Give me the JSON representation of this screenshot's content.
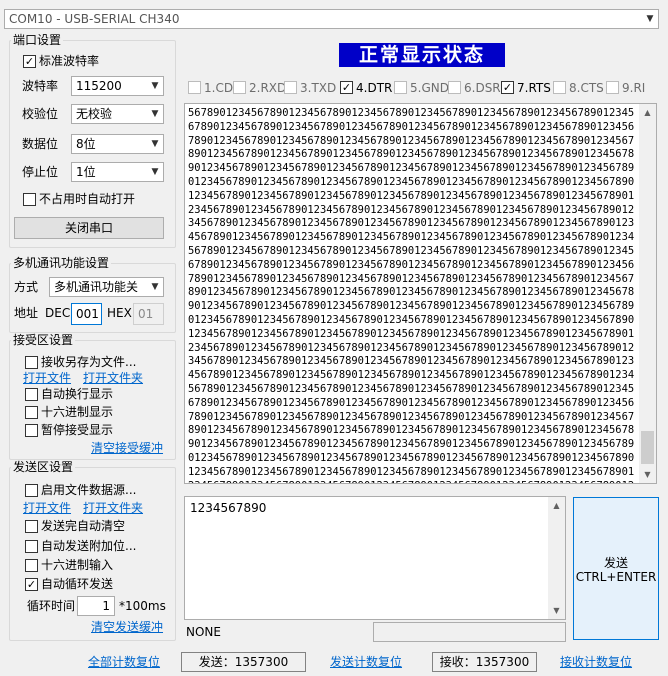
{
  "titlebar": {
    "port_select": "COM10 - USB-SERIAL CH340"
  },
  "port_settings": {
    "title": "端口设置",
    "standard_baud": {
      "label": "标准波特率",
      "checked": true
    },
    "baud": {
      "label": "波特率",
      "value": "115200"
    },
    "parity": {
      "label": "校验位",
      "value": "无校验"
    },
    "databits": {
      "label": "数据位",
      "value": "8位"
    },
    "stopbits": {
      "label": "停止位",
      "value": "1位"
    },
    "auto_open": {
      "label": "不占用时自动打开",
      "checked": false
    },
    "close_button": "关闭串口"
  },
  "multi": {
    "title": "多机通讯功能设置",
    "mode_label": "方式",
    "mode_value": "多机通讯功能关",
    "addr_label": "地址",
    "dec_label": "DEC",
    "dec_value": "001",
    "hex_label": "HEX",
    "hex_value": "01"
  },
  "receive": {
    "title": "接受区设置",
    "save_to_file": "接收另存为文件...",
    "open_file": "打开文件",
    "open_folder": "打开文件夹",
    "auto_newline": "自动换行显示",
    "hex_display": "十六进制显示",
    "pause_display": "暂停接受显示",
    "clear": "清空接受缓冲"
  },
  "send": {
    "title": "发送区设置",
    "enable_file": "启用文件数据源...",
    "open_file": "打开文件",
    "open_folder": "打开文件夹",
    "auto_clear": "发送完自动清空",
    "auto_append": "自动发送附加位...",
    "hex_input": "十六进制输入",
    "auto_loop": {
      "label": "自动循环发送",
      "checked": true
    },
    "interval_label": "循环时间",
    "interval_value": "1",
    "interval_unit": "*100ms",
    "clear": "清空发送缓冲"
  },
  "status_banner": "正常显示状态",
  "signals": [
    {
      "label": "1.CD",
      "checked": false,
      "active": false
    },
    {
      "label": "2.RXD",
      "checked": false,
      "active": false
    },
    {
      "label": "3.TXD",
      "checked": false,
      "active": false
    },
    {
      "label": "4.DTR",
      "checked": true,
      "active": true
    },
    {
      "label": "5.GND",
      "checked": false,
      "active": false
    },
    {
      "label": "6.DSR",
      "checked": false,
      "active": false
    },
    {
      "label": "7.RTS",
      "checked": true,
      "active": true
    },
    {
      "label": "8.CTS",
      "checked": false,
      "active": false
    },
    {
      "label": "9.RI",
      "checked": false,
      "active": false
    }
  ],
  "receive_text": "56789012345678901234567890123456789012345678901234567890123456789012345678901234567890123456789012345678901234567890123456789012345678901234567890123456789012345678901234567890123456789012345678901234567890123456789012345678901234567890123456789012345678901234567890123456789012345678901234567890123456789012345678901234567890123456789012345678901234567890123456789012345678901234567890123456789012345678901234567890123456789012345678901234567890123456789012345678901234567890123456789012345678901234567890123456789012345678901234567890123456789012345678901234567890123456789012345678901234567890123456789012345678901234567890123456789012345678901234567890123456789012345678901234567890123456789012345678901234567890123456789012345678901234567890123456789012345678901234567890123456789012345678901234567890123456789012345678901234567890123456789012345678901234567890123456789012345678901234567890123456789012345678901234567890123456789012345678901234567890123456789012345678901234567890123456789012345678901234567890123456789012345678901234567890123456789012345678901234567890123456789012345678901234567890123456789012345678901234567890123456789012345678901234567890123456789012345678901234567890123456789012345678901234567890123456789012345678901234567890123456789012345678901234567890123456789012345678901234567890123456789012345678901234567890123456789012345678901234567890123456789012345678901234567890123456789012345678901234567890123456789012345678901234567890123456789012345678901234567890123456789012345678901234567890123456789012345678901234567890123456789012345678901234567890123456789012345678901234567890123456789012345678901234567890123456789012345678901234567890123456789012345678901234567890123456789012345678901234567890123456789012345678901234567890123456789012345678901234567890123456789012345678901234567890123456789012345678901234567890123456789012345678901234567890123456789012345678901234567890123456789012345678901234567890123456789012345678901234567890123456789012345678901234567890123456789012345678901234567890123456789012345678901234567890",
  "send_text": "1234567890",
  "send_button": {
    "line1": "发送",
    "line2": "CTRL+ENTER"
  },
  "status_text": "NONE",
  "bottom": {
    "reset_all": "全部计数复位",
    "sent": "发送：1357300",
    "reset_sent": "发送计数复位",
    "received": "接收：1357300",
    "reset_received": "接收计数复位"
  },
  "colors": {
    "banner_bg": "#0000c8",
    "banner_fg": "#ffffff",
    "link": "#0066cc"
  }
}
